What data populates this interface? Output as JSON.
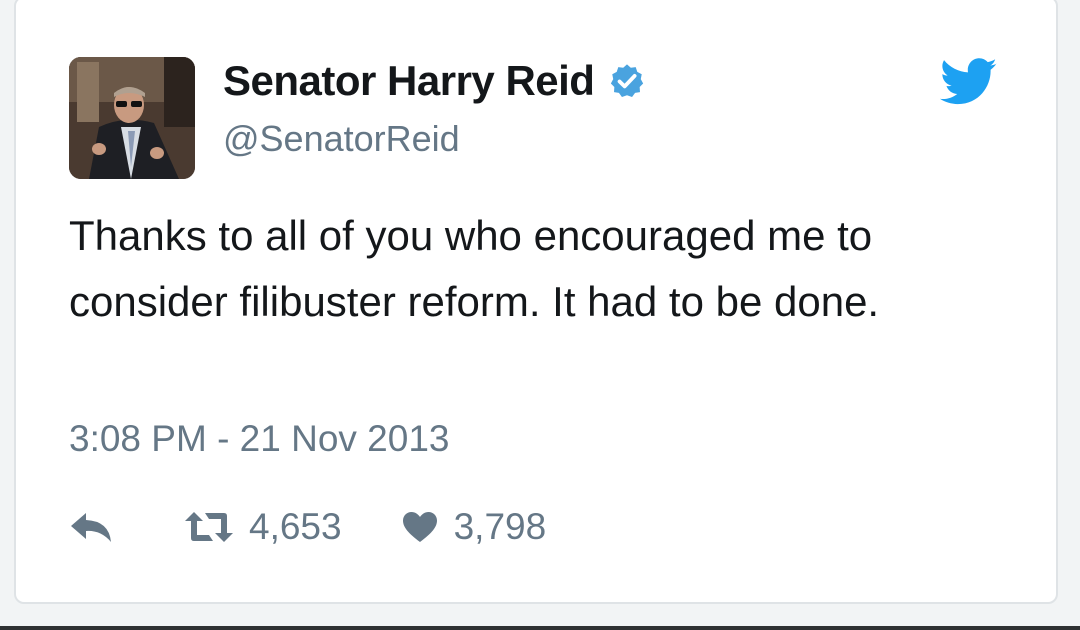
{
  "tweet": {
    "display_name": "Senator Harry Reid",
    "handle": "@SenatorReid",
    "text": "Thanks to all of you who encouraged me to consider filibuster reform. It had to be done.",
    "timestamp": "3:08 PM - 21 Nov 2013",
    "retweets": "4,653",
    "likes": "3,798",
    "verified": true
  },
  "icons": {
    "verified": "verified-badge-icon",
    "brand": "twitter-bird-icon",
    "reply": "reply-icon",
    "retweet": "retweet-icon",
    "like": "heart-icon"
  },
  "colors": {
    "text": "#14171a",
    "muted": "#657786",
    "brand_blue": "#1da1f2",
    "verified_blue": "#4aa3df",
    "card_bg": "#ffffff",
    "page_bg": "#f2f4f5"
  }
}
